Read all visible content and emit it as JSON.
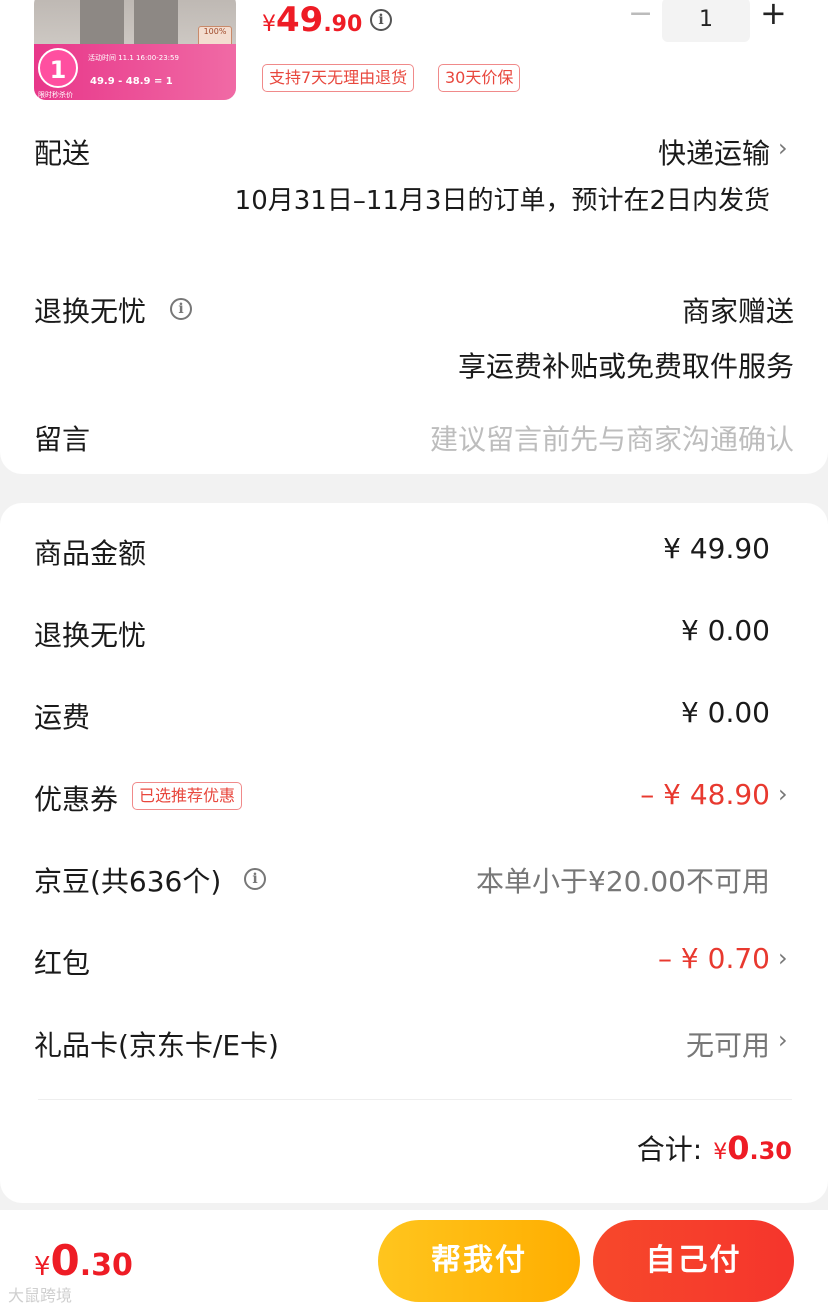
{
  "product": {
    "thumb_badge": "1",
    "thumb_badge_caption": "限时秒杀价",
    "thumb_time": "活动时间 11.1 16:00-23:59",
    "thumb_calc": "49.9 - 48.9 = 1",
    "thumb_tag": "100%",
    "price_symbol": "¥",
    "price_int": "49",
    "price_dec": ".90",
    "qty": "1",
    "minus": "−",
    "plus": "+",
    "tags": [
      "支持7天无理由退货",
      "30天价保"
    ]
  },
  "shipping": {
    "label": "配送",
    "value": "快递运输",
    "note": "10月31日–11月3日的订单，预计在2日内发货"
  },
  "returns": {
    "label": "退换无忧",
    "value": "商家赠送",
    "note": "享运费补贴或免费取件服务"
  },
  "message": {
    "label": "留言",
    "placeholder": "建议留言前先与商家沟通确认"
  },
  "summary": {
    "rows": [
      {
        "label": "商品金额",
        "value": "¥ 49.90"
      },
      {
        "label": "退换无忧",
        "value": "¥ 0.00"
      },
      {
        "label": "运费",
        "value": "¥ 0.00"
      },
      {
        "label": "优惠券",
        "tag": "已选推荐优惠",
        "value": "– ¥ 48.90"
      },
      {
        "label": "京豆(共636个)",
        "value": "本单小于¥20.00不可用"
      },
      {
        "label": "红包",
        "value": "– ¥ 0.70"
      },
      {
        "label": "礼品卡(京东卡/E卡)",
        "value": "无可用"
      }
    ],
    "total_label": "合计:",
    "total_symbol": "¥",
    "total_int": "0",
    "total_dec": ".30"
  },
  "footer": {
    "price_symbol": "¥",
    "price_int": "0",
    "price_dec": ".30",
    "help_pay": "帮我付",
    "self_pay": "自己付",
    "watermark": "大鼠跨境"
  },
  "colors": {
    "accent_red": "#ee1c25",
    "button_yellow": "#ffb90f",
    "button_red": "#f5402c"
  }
}
